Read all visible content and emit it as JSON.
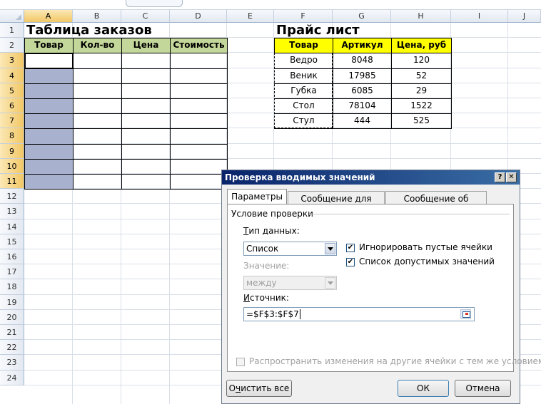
{
  "columns": [
    "A",
    "B",
    "C",
    "D",
    "E",
    "F",
    "G",
    "H",
    "I",
    "J"
  ],
  "rows": [
    "1",
    "2",
    "3",
    "4",
    "5",
    "6",
    "7",
    "8",
    "9",
    "10",
    "11",
    "12",
    "13",
    "14",
    "15",
    "16",
    "17",
    "18",
    "19",
    "20",
    "21",
    "22",
    "23",
    "24"
  ],
  "sheet": {
    "orders_title": "Таблица заказов",
    "price_title": "Прайс лист",
    "orders_headers": [
      "Товар",
      "Кол-во",
      "Цена",
      "Стоимость"
    ],
    "price_headers": [
      "Товар",
      "Артикул",
      "Цена, руб"
    ],
    "price_rows": [
      [
        "Ведро",
        "8048",
        "120"
      ],
      [
        "Веник",
        "17985",
        "52"
      ],
      [
        "Губка",
        "6085",
        "29"
      ],
      [
        "Стол",
        "78104",
        "1522"
      ],
      [
        "Стул",
        "444",
        "525"
      ]
    ]
  },
  "dialog": {
    "title": "Проверка вводимых значений",
    "help_button": "?",
    "close_button": "✕",
    "tabs": [
      "Параметры",
      "Сообщение для ввода",
      "Сообщение об ошибке"
    ],
    "group_label": "Условие проверки",
    "data_type_label": "Тип данных:",
    "data_type_value": "Список",
    "value_label": "Значение:",
    "value_value": "между",
    "ignore_blank_label": "Игнорировать пустые ячейки",
    "in_cell_dropdown_label": "Список допустимых значений",
    "source_label": "Источник:",
    "source_value": "=$F$3:$F$7",
    "apply_all_label": "Распространить изменения на другие ячейки с тем же условием",
    "clear_all_button": "Очистить все",
    "ok_button": "ОК",
    "cancel_button": "Отмена"
  },
  "colors": {
    "header_green": "#c4d79b",
    "header_yellow": "#ffff00",
    "selection": "#a8b1cd",
    "titlebar": "#0a246a"
  }
}
